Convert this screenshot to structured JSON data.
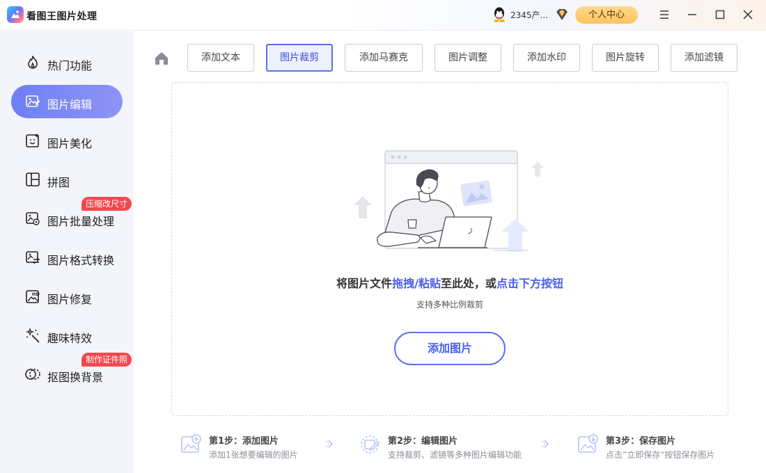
{
  "app": {
    "title": "看图王图片处理"
  },
  "header": {
    "username": "2345产...",
    "user_center_label": "个人中心"
  },
  "sidebar": {
    "items": [
      {
        "label": "热门功能",
        "icon": "fire-icon"
      },
      {
        "label": "图片编辑",
        "icon": "image-edit-icon",
        "active": true
      },
      {
        "label": "图片美化",
        "icon": "image-beautify-icon"
      },
      {
        "label": "拼图",
        "icon": "collage-icon"
      },
      {
        "label": "图片批量处理",
        "icon": "batch-image-icon",
        "badge": "压缩改尺寸"
      },
      {
        "label": "图片格式转换",
        "icon": "format-convert-icon"
      },
      {
        "label": "图片修复",
        "icon": "hd-repair-icon"
      },
      {
        "label": "趣味特效",
        "icon": "magic-wand-icon"
      },
      {
        "label": "抠图换背景",
        "icon": "cutout-icon",
        "badge": "制作证件照"
      }
    ]
  },
  "toolbar": {
    "tabs": [
      {
        "label": "添加文本"
      },
      {
        "label": "图片裁剪",
        "active": true
      },
      {
        "label": "添加马赛克"
      },
      {
        "label": "图片调整"
      },
      {
        "label": "添加水印"
      },
      {
        "label": "图片旋转"
      },
      {
        "label": "添加滤镜"
      }
    ]
  },
  "dropzone": {
    "text_1": "将图片文件",
    "text_2": "拖拽/粘贴",
    "text_3": "至此处，或",
    "text_4": "点击下方按钮",
    "subtitle": "支持多种比例裁剪",
    "add_button": "添加图片"
  },
  "steps": [
    {
      "title": "第1步：添加图片",
      "desc": "添加1张想要编辑的图片"
    },
    {
      "title": "第2步：编辑图片",
      "desc": "支持裁剪、滤镜等多种图片编辑功能"
    },
    {
      "title": "第3步：保存图片",
      "desc": "点击”立即保存“按钮保存图片"
    }
  ],
  "colors": {
    "accent": "#5b6ff0",
    "badge": "#f2484d",
    "user_center": "#fbc35c"
  }
}
